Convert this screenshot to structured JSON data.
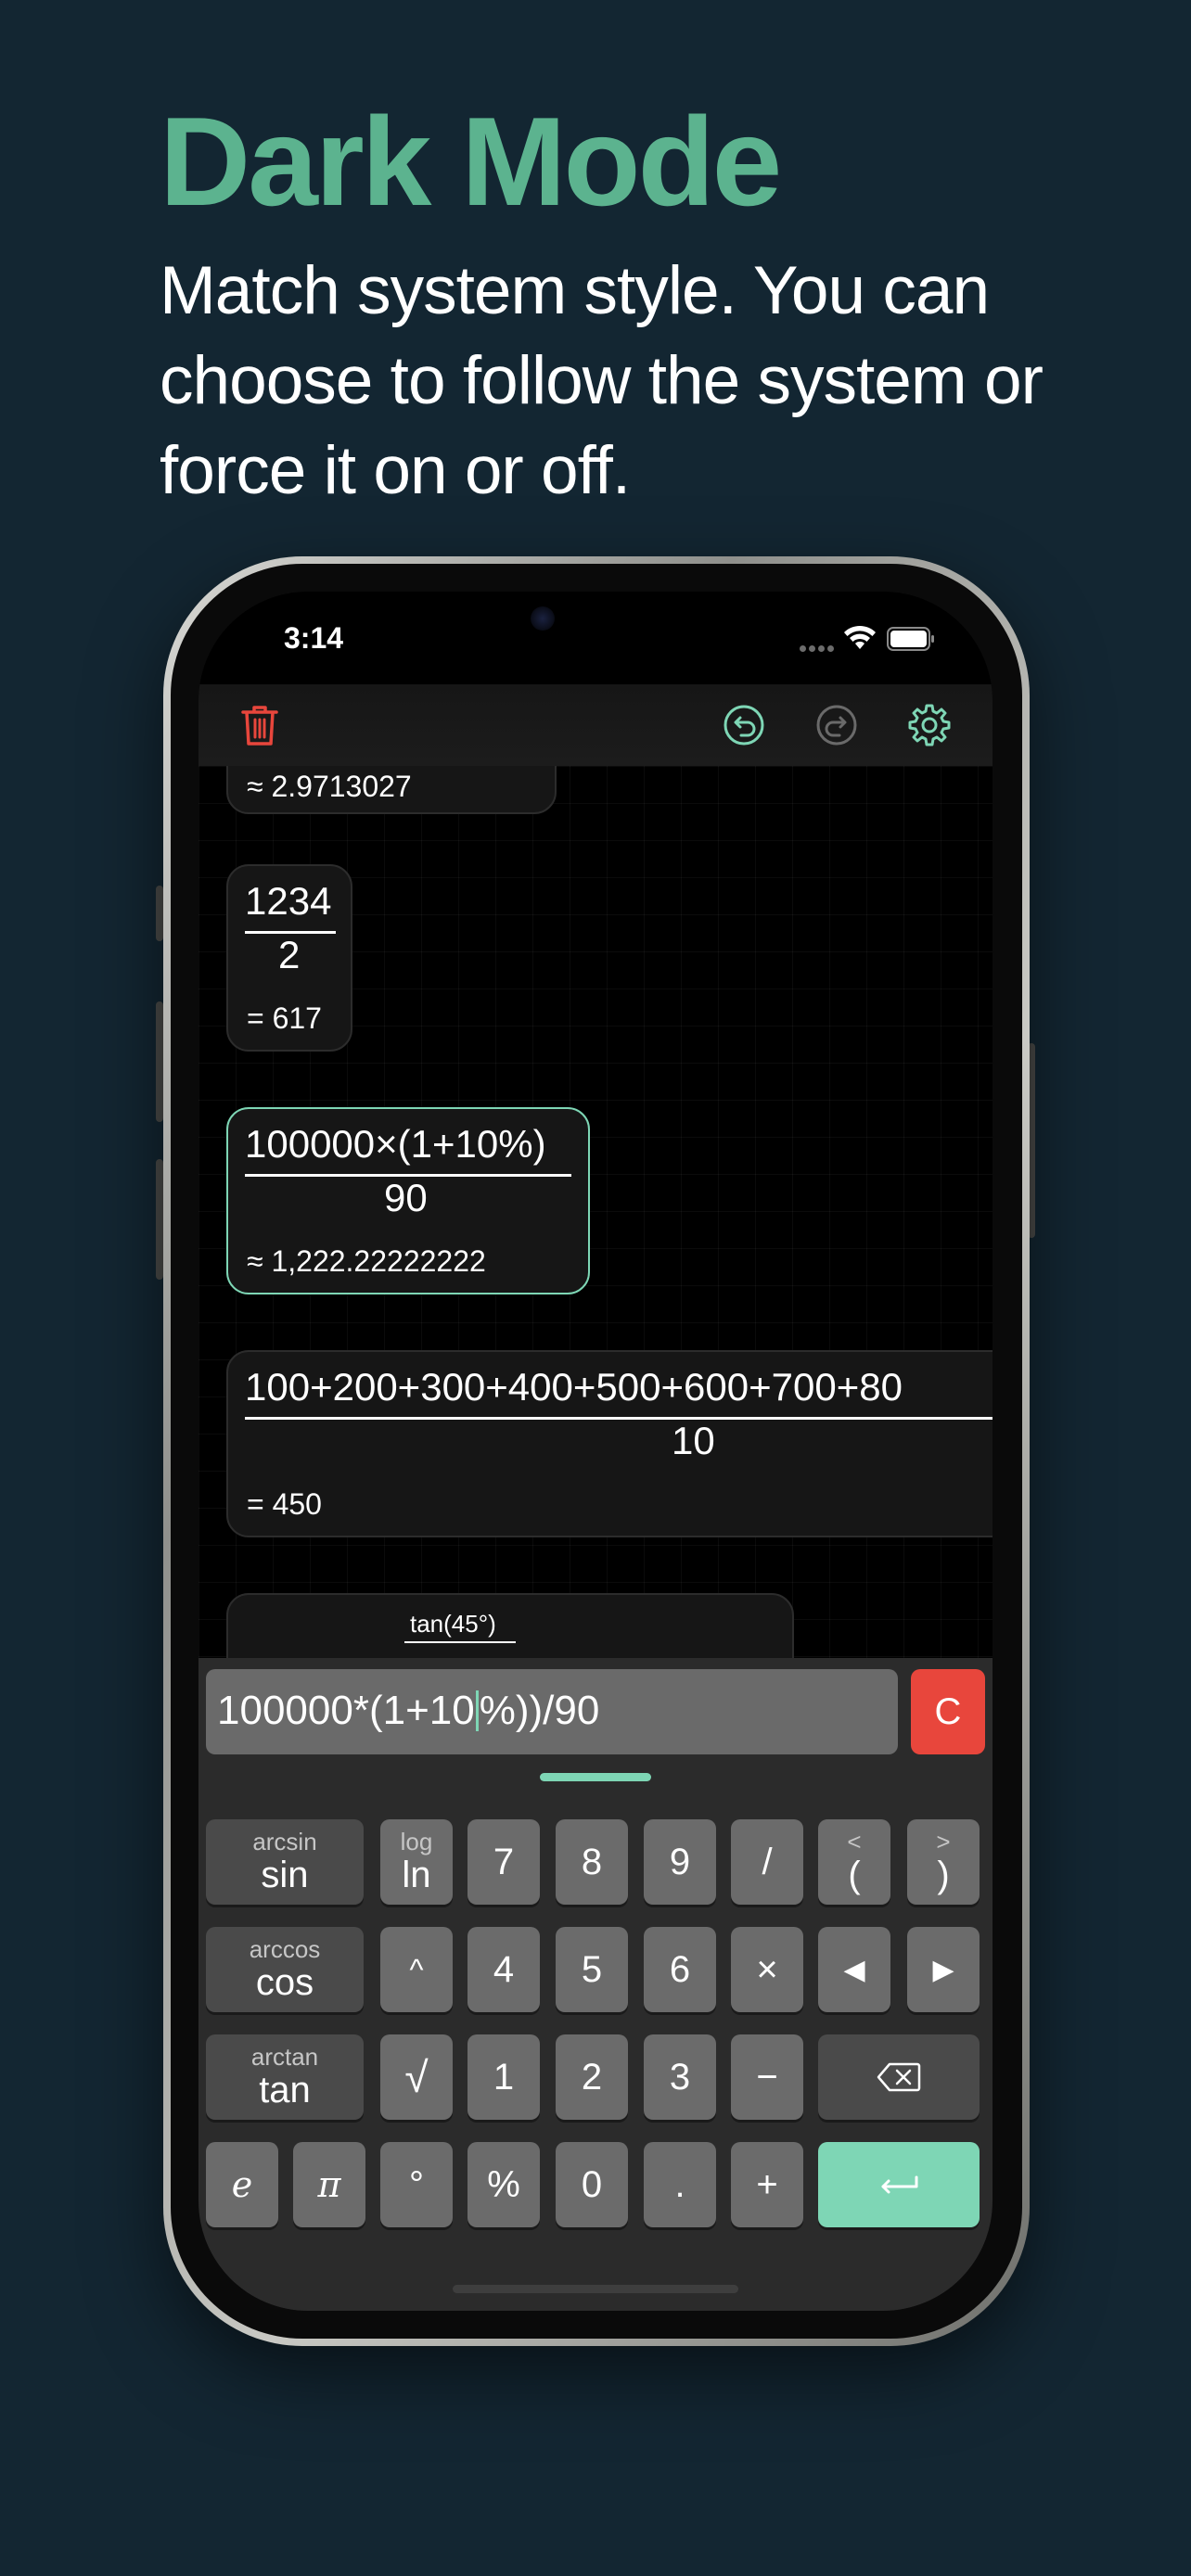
{
  "header": {
    "title": "Dark Mode",
    "subtitle": "Match system style. You can choose to follow the system or force it on or off."
  },
  "status_bar": {
    "time": "3:14"
  },
  "toolbar": {
    "icons": [
      "trash-icon",
      "undo-icon",
      "redo-icon",
      "gear-icon"
    ],
    "colors": {
      "trash": "#e8463c",
      "accent": "#7ed6b5",
      "disabled": "#6a6a6a"
    }
  },
  "history": {
    "cards": [
      {
        "result": "≈ 2.9713027"
      },
      {
        "numerator": "1234",
        "denominator": "2",
        "result": "= 617"
      },
      {
        "numerator": "100000×(1+10%)",
        "denominator": "90",
        "result": "≈ 1,222.22222222",
        "active": true
      },
      {
        "numerator": "100+200+300+400+500+600+700+80",
        "denominator": "10",
        "result": "= 450"
      },
      {
        "numerator": "tan(45°)"
      }
    ]
  },
  "input": {
    "expression_before_caret": "100000*(1+10",
    "expression_after_caret": "%))/90",
    "clear_label": "C"
  },
  "keypad": {
    "rows": [
      [
        {
          "sub": "arcsin",
          "main": "sin"
        },
        {
          "sub": "log",
          "main": "ln"
        },
        {
          "main": "7"
        },
        {
          "main": "8"
        },
        {
          "main": "9"
        },
        {
          "main": "/"
        },
        {
          "sub": "<",
          "main": "("
        },
        {
          "sub": ">",
          "main": ")"
        }
      ],
      [
        {
          "sub": "arccos",
          "main": "cos"
        },
        {
          "main": "^"
        },
        {
          "main": "4"
        },
        {
          "main": "5"
        },
        {
          "main": "6"
        },
        {
          "main": "×"
        },
        {
          "main": "◀"
        },
        {
          "main": "▶"
        }
      ],
      [
        {
          "sub": "arctan",
          "main": "tan"
        },
        {
          "main": "√"
        },
        {
          "main": "1"
        },
        {
          "main": "2"
        },
        {
          "main": "3"
        },
        {
          "main": "−"
        },
        {
          "icon": "backspace-icon"
        }
      ],
      [
        {
          "main": "e"
        },
        {
          "main": "π"
        },
        {
          "main": "°"
        },
        {
          "main": "%"
        },
        {
          "main": "0"
        },
        {
          "main": "."
        },
        {
          "main": "+"
        },
        {
          "icon": "enter-icon"
        }
      ]
    ]
  }
}
